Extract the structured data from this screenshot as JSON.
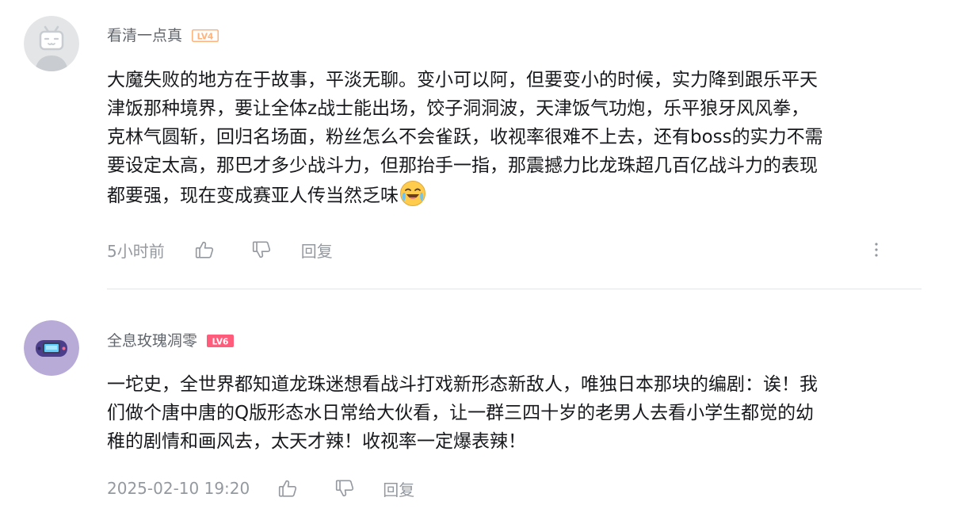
{
  "comments": [
    {
      "username": "看清一点真",
      "level": "LV4",
      "level_color": "#ffb37c",
      "avatar_icon": "bilibili-tv-default-avatar",
      "content_lines": [
        "大魔失败的地方在于故事，平淡无聊。变小可以阿，但要变小的时候，实力降到跟乐平天",
        "津饭那种境界，要让全体z战士能出场，饺子洞洞波，天津饭气功炮，乐平狼牙风风拳，",
        "克林气圆斩，回归名场面，粉丝怎么不会雀跃，收视率很难不上去，还有boss的实力不需",
        "要设定太高，那巴才多少战斗力，但那抬手一指，那震撼力比龙珠超几百亿战斗力的表现",
        "都要强，现在变成赛亚人传当然乏味"
      ],
      "trailing_emoji": "laughing-crying-emoji",
      "time": "5小时前",
      "like_icon": "thumbs-up-icon",
      "dislike_icon": "thumbs-down-icon",
      "reply_label": "回复",
      "more_icon": "more-vertical-icon"
    },
    {
      "username": "全息玫瑰凋零",
      "level": "LV6",
      "level_color": "#ff5c7c",
      "avatar_icon": "game-console-avatar",
      "content_lines": [
        "一坨史，全世界都知道龙珠迷想看战斗打戏新形态新敌人，唯独日本那块的编剧：诶！我",
        "们做个唐中唐的Q版形态水日常给大伙看，让一群三四十岁的老男人去看小学生都觉的幼",
        "稚的剧情和画风去，太天才辣！收视率一定爆表辣！"
      ],
      "time": "2025-02-10 19:20",
      "like_icon": "thumbs-up-icon",
      "dislike_icon": "thumbs-down-icon",
      "reply_label": "回复"
    }
  ]
}
